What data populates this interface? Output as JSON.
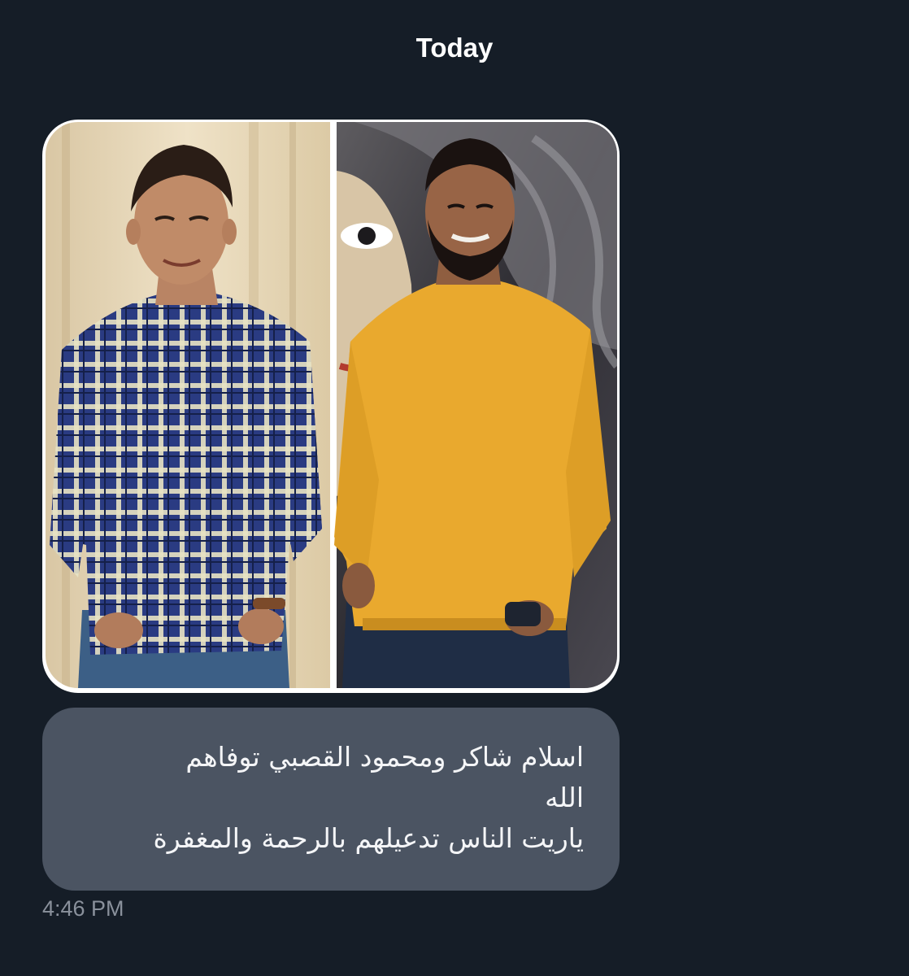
{
  "conversation": {
    "date_header": "Today"
  },
  "messages": [
    {
      "type": "photo",
      "content": "two side-by-side portrait photos: young man in blue plaid shirt (left), bearded man in yellow sweater (right)"
    },
    {
      "type": "text",
      "lines": [
        "اسلام شاكر ومحمود القصبي توفاهم",
        "الله",
        "ياريت الناس تدعيلهم بالرحمة والمغفرة"
      ],
      "time": "4:46 PM"
    }
  ],
  "colors": {
    "background": "#151d27",
    "bubble": "#4b5462",
    "timestamp": "#8a919c",
    "left_shirt": "#2d3f86",
    "right_sweater": "#e9a92e"
  }
}
